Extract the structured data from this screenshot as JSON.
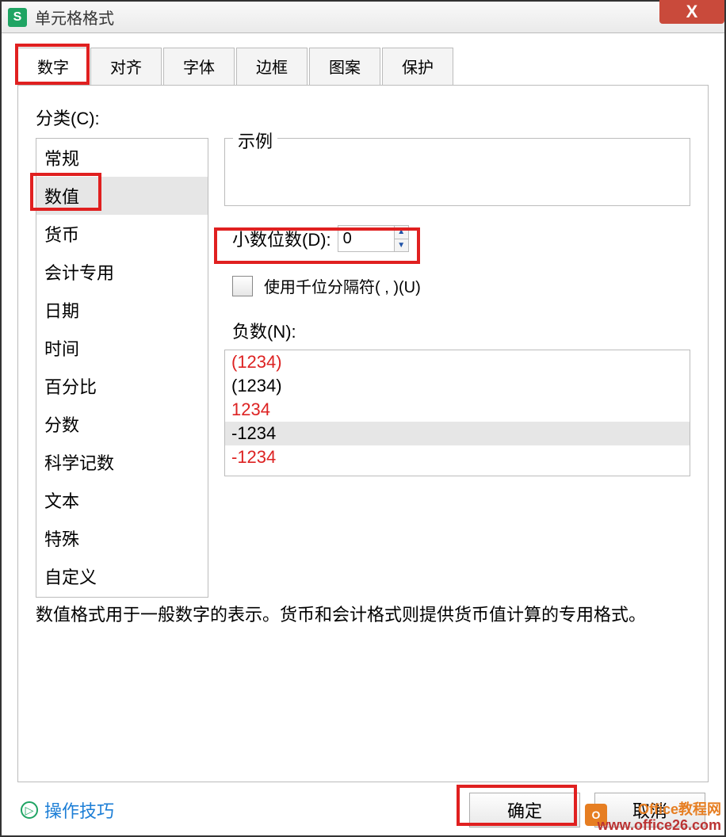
{
  "window": {
    "app_icon_letter": "S",
    "title": "单元格格式",
    "close_glyph": "X"
  },
  "tabs": [
    {
      "id": "number",
      "label": "数字",
      "active": true
    },
    {
      "id": "align",
      "label": "对齐",
      "active": false
    },
    {
      "id": "font",
      "label": "字体",
      "active": false
    },
    {
      "id": "border",
      "label": "边框",
      "active": false
    },
    {
      "id": "pattern",
      "label": "图案",
      "active": false
    },
    {
      "id": "protect",
      "label": "保护",
      "active": false
    }
  ],
  "panel": {
    "category_label": "分类(C):",
    "categories": [
      {
        "id": "general",
        "label": "常规",
        "selected": false
      },
      {
        "id": "number",
        "label": "数值",
        "selected": true
      },
      {
        "id": "currency",
        "label": "货币",
        "selected": false
      },
      {
        "id": "accounting",
        "label": "会计专用",
        "selected": false
      },
      {
        "id": "date",
        "label": "日期",
        "selected": false
      },
      {
        "id": "time",
        "label": "时间",
        "selected": false
      },
      {
        "id": "percent",
        "label": "百分比",
        "selected": false
      },
      {
        "id": "fraction",
        "label": "分数",
        "selected": false
      },
      {
        "id": "scientific",
        "label": "科学记数",
        "selected": false
      },
      {
        "id": "text",
        "label": "文本",
        "selected": false
      },
      {
        "id": "special",
        "label": "特殊",
        "selected": false
      },
      {
        "id": "custom",
        "label": "自定义",
        "selected": false
      }
    ],
    "sample_label": "示例",
    "sample_value": "",
    "decimal_label": "小数位数(D):",
    "decimal_value": "0",
    "thousands_label": "使用千位分隔符( , )(U)",
    "thousands_checked": false,
    "negative_label": "负数(N):",
    "negative_formats": [
      {
        "text": "(1234)",
        "red": true,
        "selected": false
      },
      {
        "text": "(1234)",
        "red": false,
        "selected": false
      },
      {
        "text": "1234",
        "red": true,
        "selected": false
      },
      {
        "text": "-1234",
        "red": false,
        "selected": true
      },
      {
        "text": "-1234",
        "red": true,
        "selected": false
      }
    ],
    "description": "数值格式用于一般数字的表示。货币和会计格式则提供货币值计算的专用格式。"
  },
  "footer": {
    "help_link": "操作技巧",
    "ok_label": "确定",
    "cancel_label": "取消"
  },
  "watermark": {
    "line1": "Office教程网",
    "line2": "www.office26.com"
  }
}
